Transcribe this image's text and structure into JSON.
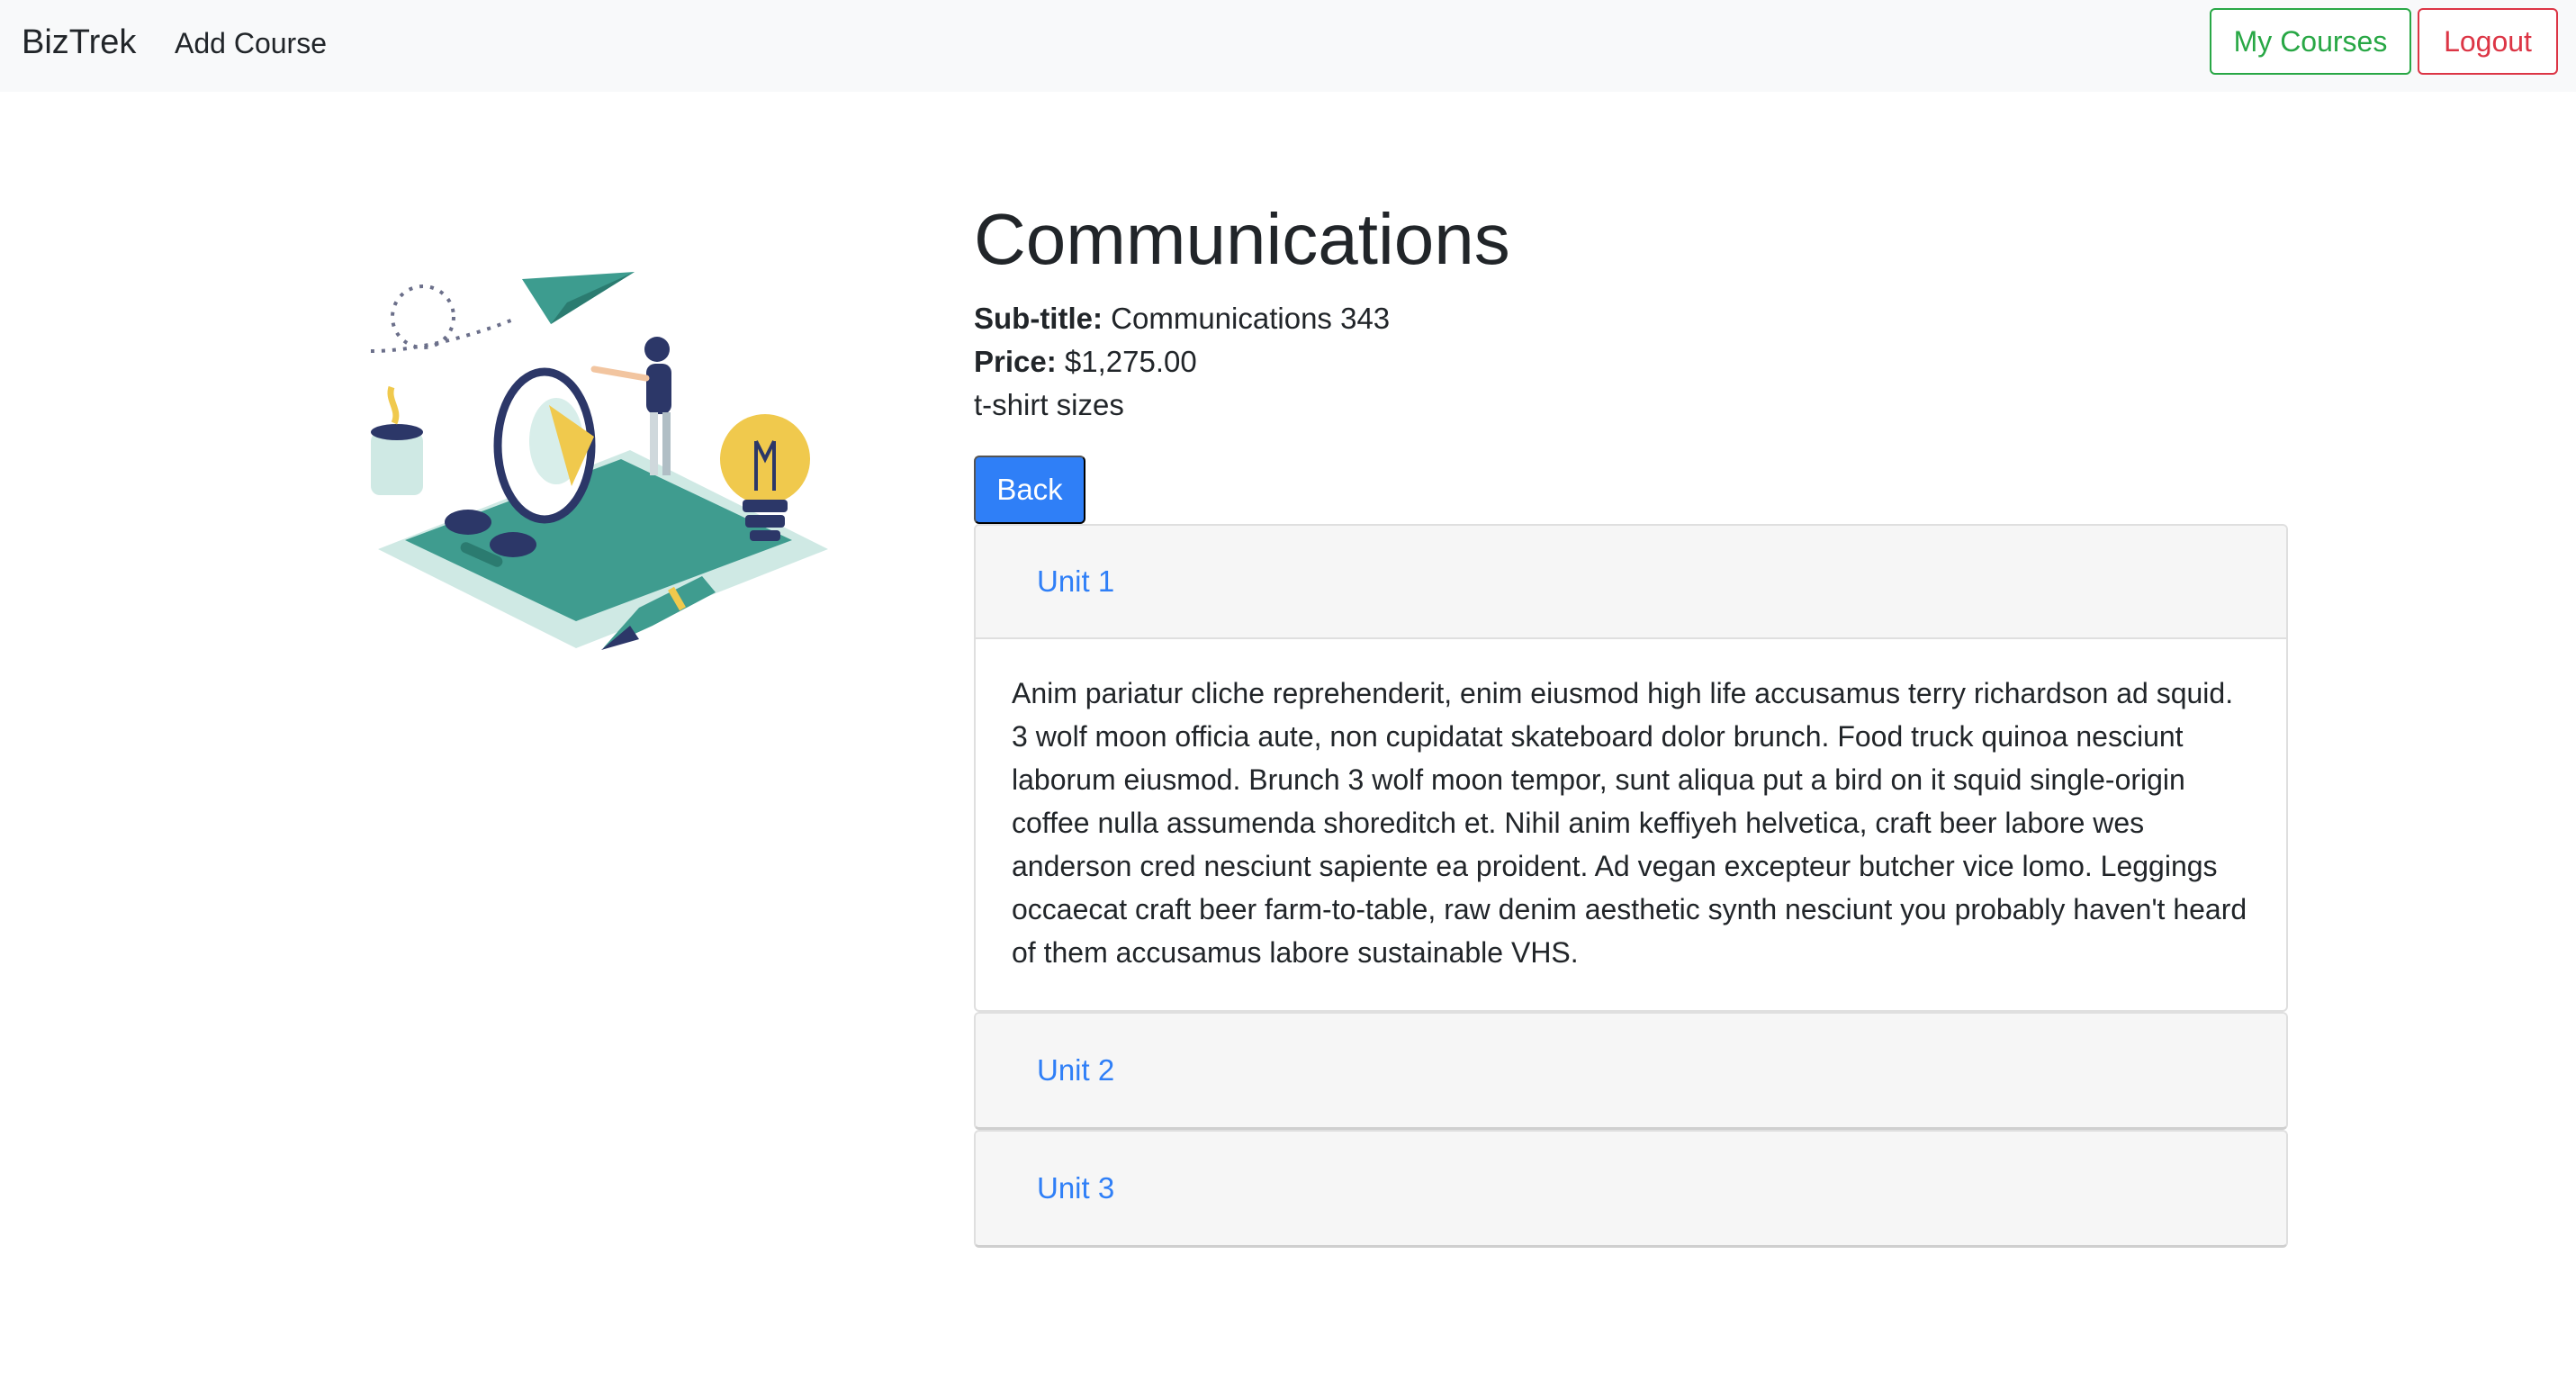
{
  "navbar": {
    "brand": "BizTrek",
    "add_course_label": "Add Course",
    "my_courses_label": "My Courses",
    "logout_label": "Logout",
    "colors": {
      "my_courses": "#28a745",
      "logout": "#dc3545"
    }
  },
  "course": {
    "title": "Communications",
    "subtitle_label": "Sub-title:",
    "subtitle_value": "Communications 343",
    "price_label": "Price:",
    "price_value": "$1,275.00",
    "description": "t-shirt sizes",
    "back_label": "Back",
    "image_icon": "megaphone-phone-illustration"
  },
  "units": [
    {
      "label": "Unit 1",
      "expanded": true,
      "body": "Anim pariatur cliche reprehenderit, enim eiusmod high life accusamus terry richardson ad squid. 3 wolf moon officia aute, non cupidatat skateboard dolor brunch. Food truck quinoa nesciunt laborum eiusmod. Brunch 3 wolf moon tempor, sunt aliqua put a bird on it squid single-origin coffee nulla assumenda shoreditch et. Nihil anim keffiyeh helvetica, craft beer labore wes anderson cred nesciunt sapiente ea proident. Ad vegan excepteur butcher vice lomo. Leggings occaecat craft beer farm-to-table, raw denim aesthetic synth nesciunt you probably haven't heard of them accusamus labore sustainable VHS."
    },
    {
      "label": "Unit 2",
      "expanded": false
    },
    {
      "label": "Unit 3",
      "expanded": false
    }
  ],
  "accent_color": "#2f7ff7"
}
